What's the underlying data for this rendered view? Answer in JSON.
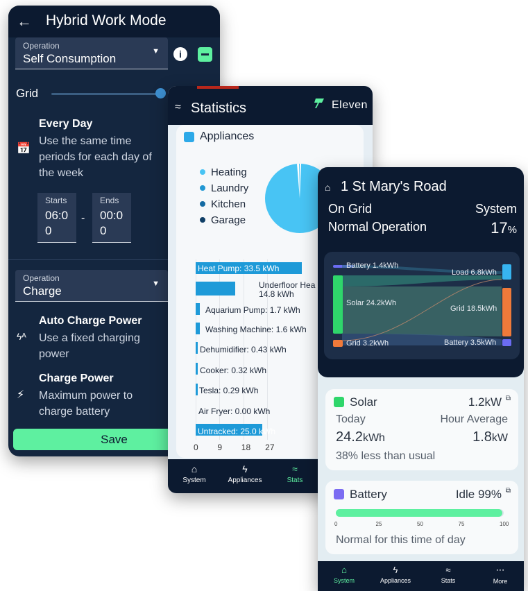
{
  "hybrid": {
    "title": "Hybrid Work Mode",
    "operation1": {
      "label": "Operation",
      "value": "Self Consumption"
    },
    "grid_label": "Grid",
    "every_day": {
      "title": "Every Day",
      "desc": "Use the same time periods for each day of the week"
    },
    "starts": {
      "label": "Starts",
      "value": "06:00"
    },
    "ends": {
      "label": "Ends",
      "value": "00:00"
    },
    "dash": "-",
    "operation2": {
      "label": "Operation",
      "value": "Charge"
    },
    "auto_charge": {
      "title": "Auto Charge Power",
      "desc": "Use a fixed charging power"
    },
    "charge_power": {
      "title": "Charge Power",
      "desc": "Maximum power to charge battery"
    },
    "save": "Save",
    "colors": {
      "bg": "#14263f",
      "accent": "#5ef0a0"
    }
  },
  "statistics": {
    "title": "Statistics",
    "brand": "Eleven",
    "card_title": "Appliances",
    "legend": [
      {
        "name": "Heating",
        "color": "#48c4f4"
      },
      {
        "name": "Laundry",
        "color": "#2197d3"
      },
      {
        "name": "Kitchen",
        "color": "#136aa3"
      },
      {
        "name": "Garage",
        "color": "#0f3e66"
      }
    ],
    "nav": [
      {
        "icon": "home-icon",
        "label": "System"
      },
      {
        "icon": "bolt-icon",
        "label": "Appliances"
      },
      {
        "icon": "stats-icon",
        "label": "Stats"
      }
    ],
    "chart_data": {
      "type": "bar",
      "orientation": "horizontal",
      "categories": [
        "Heat Pump",
        "Underfloor Heating",
        "Aquarium Pump",
        "Washing Machine",
        "Dehumidifier",
        "Cooker",
        "Tesla",
        "Air Fryer",
        "Untracked"
      ],
      "values": [
        33.5,
        14.8,
        1.7,
        1.6,
        0.43,
        0.32,
        0.29,
        0.0,
        25.0
      ],
      "labels": [
        "Heat Pump: 33.5 kWh",
        "Underfloor Hea",
        "14.8 kWh",
        "Aquarium Pump: 1.7 kWh",
        "Washing Machine: 1.6 kWh",
        "Dehumidifier: 0.43 kWh",
        "Cooker: 0.32 kWh",
        "Tesla: 0.29 kWh",
        "Air Fryer: 0.00 kWh",
        "Untracked: 25.0 kWh"
      ],
      "xticks": [
        "0",
        "9",
        "18",
        "27"
      ],
      "xlim": [
        0,
        33.5
      ]
    }
  },
  "home": {
    "address": "1 St Mary's Road",
    "status_left": "On Grid",
    "status_right": "System",
    "operation": "Normal Operation",
    "percent": "17",
    "percent_unit": "%",
    "flows": {
      "battery_in": "Battery 1.4kWh",
      "load": "Load 6.8kWh",
      "solar": "Solar 24.2kWh",
      "grid_out": "Grid 18.5kWh",
      "grid_in": "Grid 3.2kWh",
      "battery_out": "Battery 3.5kWh"
    },
    "solar": {
      "title": "Solar",
      "power": "1.2kW",
      "today_label": "Today",
      "avg_label": "Hour Average",
      "today_value": "24.2",
      "today_unit": "kWh",
      "avg_value": "1.8",
      "avg_unit": "kW",
      "note": "38% less than usual"
    },
    "battery": {
      "title": "Battery",
      "status": "Idle 99%",
      "level": 0.99,
      "scale": [
        "0",
        "25",
        "50",
        "75",
        "100"
      ],
      "note": "Normal for this time of day"
    },
    "nav": [
      {
        "icon": "home-icon",
        "label": "System"
      },
      {
        "icon": "bolt-icon",
        "label": "Appliances"
      },
      {
        "icon": "stats-icon",
        "label": "Stats"
      },
      {
        "icon": "more-icon",
        "label": "More"
      }
    ]
  }
}
